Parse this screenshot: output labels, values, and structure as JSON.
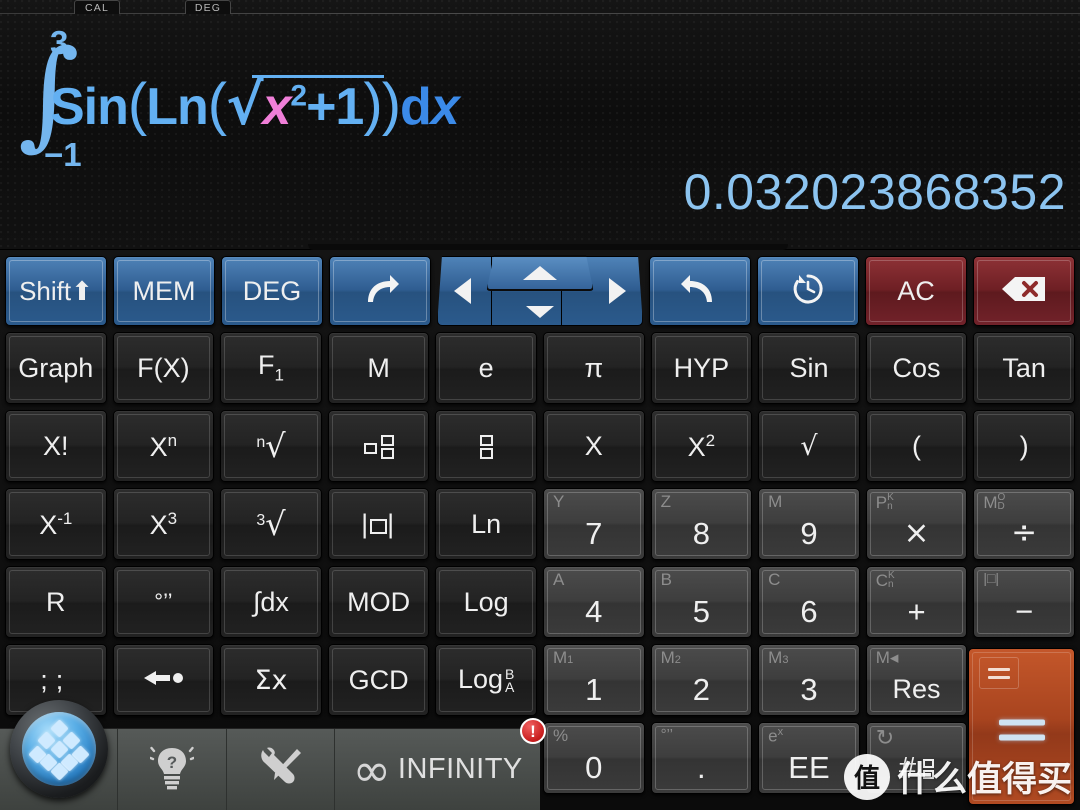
{
  "display": {
    "tabs": [
      {
        "label": "CAL",
        "name": "tab-cal"
      },
      {
        "label": "DEG",
        "name": "tab-deg"
      }
    ],
    "formula": {
      "upper_limit": "3",
      "lower_limit": "−1",
      "expression": "Sin(Ln(√(x²+1)))dx",
      "plain": "∫ from -1 to 3 of Sin(Ln(√(x^2+1))) dx",
      "func_outer": "Sin",
      "func_inner": "Ln",
      "variable": "x",
      "exponent": "2",
      "addend": "+1",
      "differential": "dx",
      "colors": {
        "function": "#63b0f2",
        "variable": "#f07fd8",
        "differential": "#3b8ae8",
        "result": "#8cc4f0"
      }
    },
    "result": "0.032023868352"
  },
  "keypad": {
    "row1": [
      {
        "name": "shift-key",
        "label": "Shift⬆",
        "style": "k-blue"
      },
      {
        "name": "mem-key",
        "label": "MEM",
        "style": "k-blue"
      },
      {
        "name": "deg-key",
        "label": "DEG",
        "style": "k-blue"
      },
      {
        "name": "redo-key",
        "label": "↪",
        "style": "k-blue",
        "icon": "redo-arrow-icon"
      },
      {
        "name": "nav-pad",
        "label": "",
        "style": "k-blue",
        "icon": "direction-pad"
      },
      {
        "name": "undo-key",
        "label": "↩",
        "style": "k-blue",
        "icon": "undo-arrow-icon"
      },
      {
        "name": "history-key",
        "label": "↺",
        "style": "k-blue",
        "icon": "history-clock-icon"
      },
      {
        "name": "ac-key",
        "label": "AC",
        "style": "k-red"
      },
      {
        "name": "backspace-key",
        "label": "⌫",
        "style": "k-red",
        "icon": "backspace-icon"
      }
    ],
    "row2": [
      {
        "name": "graph-key",
        "label": "Graph",
        "style": "k-dark"
      },
      {
        "name": "fx-key",
        "label": "F(X)",
        "style": "k-dark"
      },
      {
        "name": "f1-key",
        "label": "F",
        "sub": "1",
        "style": "k-dark"
      },
      {
        "name": "m-key",
        "label": "M",
        "style": "k-dark"
      },
      {
        "name": "e-key",
        "label": "e",
        "style": "k-dark"
      },
      {
        "name": "pi-key",
        "label": "π",
        "style": "k-dark"
      },
      {
        "name": "hyp-key",
        "label": "HYP",
        "style": "k-dark"
      },
      {
        "name": "sin-key",
        "label": "Sin",
        "style": "k-dark"
      },
      {
        "name": "cos-key",
        "label": "Cos",
        "style": "k-dark"
      },
      {
        "name": "tan-key",
        "label": "Tan",
        "style": "k-dark"
      }
    ],
    "row3": [
      {
        "name": "factorial-key",
        "label": "X!",
        "style": "k-dark"
      },
      {
        "name": "x-power-n-key",
        "label": "X",
        "sup": "n",
        "style": "k-dark"
      },
      {
        "name": "nth-root-key",
        "label": "ⁿ√",
        "style": "k-dark",
        "icon": "nth-root-icon"
      },
      {
        "name": "mixed-fraction-key",
        "label": "",
        "style": "k-dark",
        "icon": "mixed-fraction-icon"
      },
      {
        "name": "fraction-key",
        "label": "",
        "style": "k-dark",
        "icon": "fraction-icon"
      },
      {
        "name": "x-var-key",
        "label": "X",
        "style": "k-dark"
      },
      {
        "name": "x-squared-key",
        "label": "X",
        "sup": "2",
        "style": "k-dark"
      },
      {
        "name": "sqrt-key",
        "label": "√",
        "style": "k-dark"
      },
      {
        "name": "open-paren-key",
        "label": "(",
        "style": "k-dark"
      },
      {
        "name": "close-paren-key",
        "label": ")",
        "style": "k-dark"
      }
    ],
    "row4": [
      {
        "name": "x-inverse-key",
        "label": "X",
        "sup": "-1",
        "style": "k-dark"
      },
      {
        "name": "x-cubed-key",
        "label": "X",
        "sup": "3",
        "style": "k-dark"
      },
      {
        "name": "cube-root-key",
        "label": "³√",
        "style": "k-dark",
        "icon": "cube-root-icon"
      },
      {
        "name": "absolute-value-key",
        "label": "|□|",
        "style": "k-dark",
        "icon": "absolute-value-icon"
      },
      {
        "name": "ln-key",
        "label": "Ln",
        "style": "k-dark"
      },
      {
        "name": "seven-key",
        "label": "7",
        "shift": "Y",
        "style": "k-gray"
      },
      {
        "name": "eight-key",
        "label": "8",
        "shift": "Z",
        "style": "k-gray"
      },
      {
        "name": "nine-key",
        "label": "9",
        "shift": "M",
        "style": "k-gray"
      },
      {
        "name": "multiply-key",
        "label": "×",
        "shift": "P",
        "shift_stack": [
          "K",
          "n"
        ],
        "style": "k-gray"
      },
      {
        "name": "divide-key",
        "label": "÷",
        "shift": "M",
        "shift_stack": [
          "O",
          "D"
        ],
        "style": "k-gray"
      }
    ],
    "row5": [
      {
        "name": "r-key",
        "label": "R",
        "style": "k-dark"
      },
      {
        "name": "dms-key",
        "label": "°’’",
        "style": "k-dark",
        "icon": "degree-minute-second-icon"
      },
      {
        "name": "integral-key",
        "label": "∫dx",
        "style": "k-dark"
      },
      {
        "name": "mod-key",
        "label": "MOD",
        "style": "k-dark"
      },
      {
        "name": "log-key",
        "label": "Log",
        "style": "k-dark"
      },
      {
        "name": "four-key",
        "label": "4",
        "shift": "A",
        "style": "k-gray"
      },
      {
        "name": "five-key",
        "label": "5",
        "shift": "B",
        "style": "k-gray"
      },
      {
        "name": "six-key",
        "label": "6",
        "shift": "C",
        "style": "k-gray"
      },
      {
        "name": "plus-key",
        "label": "+",
        "shift": "C",
        "shift_stack": [
          "K",
          "n"
        ],
        "style": "k-gray"
      },
      {
        "name": "minus-key",
        "label": "−",
        "shift": "|□|",
        "style": "k-gray"
      }
    ],
    "row6": [
      {
        "name": "separator-key",
        "label": ";;",
        "style": "k-dark",
        "icon": "separator-icon"
      },
      {
        "name": "store-key",
        "label": "←●",
        "style": "k-dark",
        "icon": "store-arrow-icon"
      },
      {
        "name": "sigma-x-key",
        "label": "Σx",
        "style": "k-dark"
      },
      {
        "name": "gcd-key",
        "label": "GCD",
        "style": "k-dark"
      },
      {
        "name": "log-base-key",
        "label": "Log",
        "style": "k-dark",
        "icon": "log-base-icon"
      },
      {
        "name": "one-key",
        "label": "1",
        "shift": "M",
        "shift_sub": "1",
        "style": "k-gray"
      },
      {
        "name": "two-key",
        "label": "2",
        "shift": "M",
        "shift_sub": "2",
        "style": "k-gray"
      },
      {
        "name": "three-key",
        "label": "3",
        "shift": "M",
        "shift_sub": "3",
        "style": "k-gray"
      },
      {
        "name": "res-key",
        "label": "Res",
        "shift": "M◂",
        "style": "k-gray"
      }
    ],
    "row7": [
      {
        "name": "zero-key",
        "label": "0",
        "shift": "%",
        "style": "k-gray"
      },
      {
        "name": "decimal-key",
        "label": ".",
        "shift": "°’’",
        "style": "k-gray"
      },
      {
        "name": "ee-key",
        "label": "EE",
        "shift": "e",
        "shift_sup": "x",
        "style": "k-gray"
      },
      {
        "name": "base-convert-key",
        "label": "#",
        "shift": "↻",
        "style": "k-gray",
        "icon": "refresh-icon"
      }
    ],
    "equals": {
      "name": "equals-key",
      "label": "=",
      "secondary_label": "=",
      "style": "k-orange"
    }
  },
  "bottom_bar": {
    "home_button": {
      "name": "home-button",
      "icon": "diamond-grid-icon"
    },
    "items": [
      {
        "name": "help-button",
        "icon": "lightbulb-help-icon",
        "label": ""
      },
      {
        "name": "tools-button",
        "icon": "wrench-screwdriver-icon",
        "label": ""
      },
      {
        "name": "infinity-brand",
        "icon": "infinity-icon",
        "label": "INFINITY"
      }
    ],
    "alert_badge": {
      "name": "alert-badge",
      "label": "!"
    }
  },
  "watermark": {
    "logo": "值",
    "text": "什么值得买"
  }
}
